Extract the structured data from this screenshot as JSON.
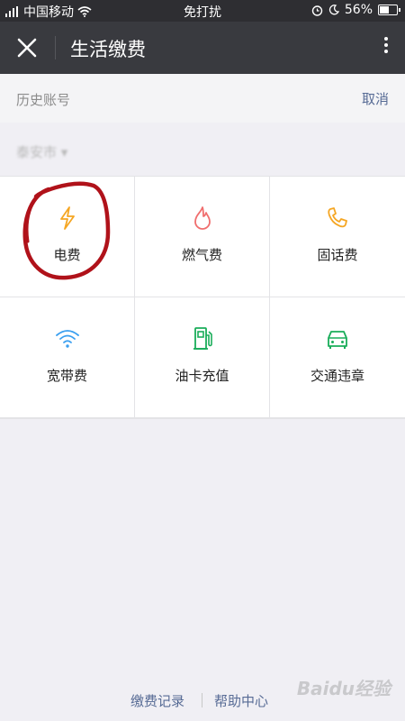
{
  "status_bar": {
    "carrier": "中国移动",
    "mode": "免打扰",
    "battery": "56%",
    "battery_level": 0.56
  },
  "header": {
    "title": "生活缴费",
    "close_icon": "close-icon",
    "more_icon": "more-vertical-icon"
  },
  "history": {
    "label": "历史账号",
    "cancel": "取消"
  },
  "location": {
    "label": "泰安市 ▾"
  },
  "grid": [
    {
      "label": "电费",
      "icon": "lightning-icon",
      "color": "#f5a623"
    },
    {
      "label": "燃气费",
      "icon": "flame-icon",
      "color": "#f06e6e"
    },
    {
      "label": "固话费",
      "icon": "phone-icon",
      "color": "#f5a623"
    },
    {
      "label": "宽带费",
      "icon": "wifi-icon",
      "color": "#3a9ff0"
    },
    {
      "label": "油卡充值",
      "icon": "fuel-pump-icon",
      "color": "#1aad5a"
    },
    {
      "label": "交通违章",
      "icon": "car-icon",
      "color": "#1aad5a"
    }
  ],
  "footer": {
    "record": "缴费记录",
    "help": "帮助中心"
  },
  "watermark": "Baidu经验",
  "colors": {
    "titlebar": "#393a3f",
    "link": "#576b95",
    "annotation": "#b0121a"
  }
}
